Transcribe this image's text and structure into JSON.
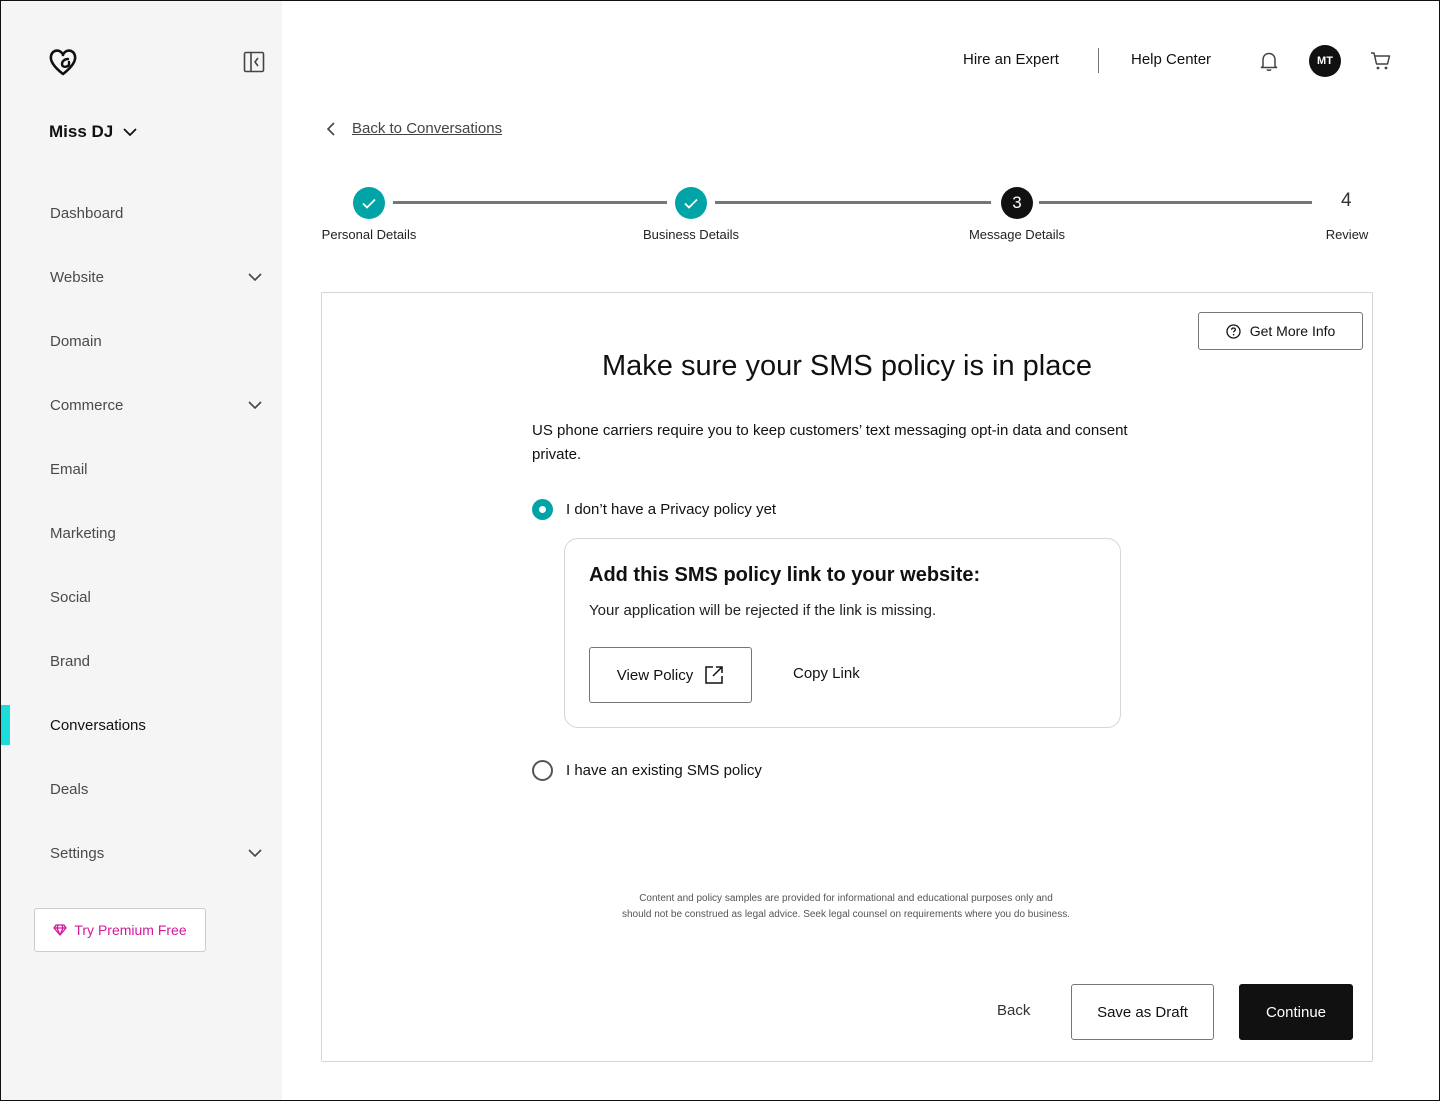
{
  "sidebar": {
    "logo_icon": "godaddy-logo-icon",
    "collapse_icon": "sidebar-collapse-icon",
    "account_name": "Miss DJ",
    "items": [
      {
        "label": "Dashboard",
        "has_chevron": false
      },
      {
        "label": "Website",
        "has_chevron": true
      },
      {
        "label": "Domain",
        "has_chevron": false
      },
      {
        "label": "Commerce",
        "has_chevron": true
      },
      {
        "label": "Email",
        "has_chevron": false
      },
      {
        "label": "Marketing",
        "has_chevron": false
      },
      {
        "label": "Social",
        "has_chevron": false
      },
      {
        "label": "Brand",
        "has_chevron": false
      },
      {
        "label": "Conversations",
        "has_chevron": false,
        "active": true
      },
      {
        "label": "Deals",
        "has_chevron": false
      },
      {
        "label": "Settings",
        "has_chevron": true
      }
    ],
    "premium_label": "Try Premium Free",
    "accent_color": "#1bdbdb",
    "premium_color": "#d4189d"
  },
  "header": {
    "hire_expert": "Hire an Expert",
    "help_center": "Help Center",
    "avatar_initials": "MT"
  },
  "back_link": "Back to Conversations",
  "stepper": {
    "steps": [
      {
        "label": "Personal Details",
        "status": "done"
      },
      {
        "label": "Business Details",
        "status": "done"
      },
      {
        "label": "Message Details",
        "status": "current",
        "number": "3"
      },
      {
        "label": "Review",
        "status": "upcoming",
        "number": "4"
      }
    ],
    "done_color": "#00a4a6"
  },
  "card": {
    "more_info": "Get More Info",
    "title": "Make sure your SMS policy is in place",
    "description": "US phone carriers require you to keep customers’ text messaging opt-in data and consent private.",
    "option_1": "I don’t have a Privacy policy yet",
    "option_2": "I have an existing SMS policy",
    "selected_option": 1,
    "policy_title": "Add this SMS policy link to your website:",
    "policy_sub": "Your application will be rejected if the link is missing.",
    "view_policy": "View Policy",
    "copy_link": "Copy Link",
    "disclaimer_line1": "Content and policy samples are provided for informational and educational purposes only and",
    "disclaimer_line2": "should not be construed as legal advice. Seek legal counsel on requirements where you do business."
  },
  "footer": {
    "back": "Back",
    "save_draft": "Save as Draft",
    "continue": "Continue"
  }
}
